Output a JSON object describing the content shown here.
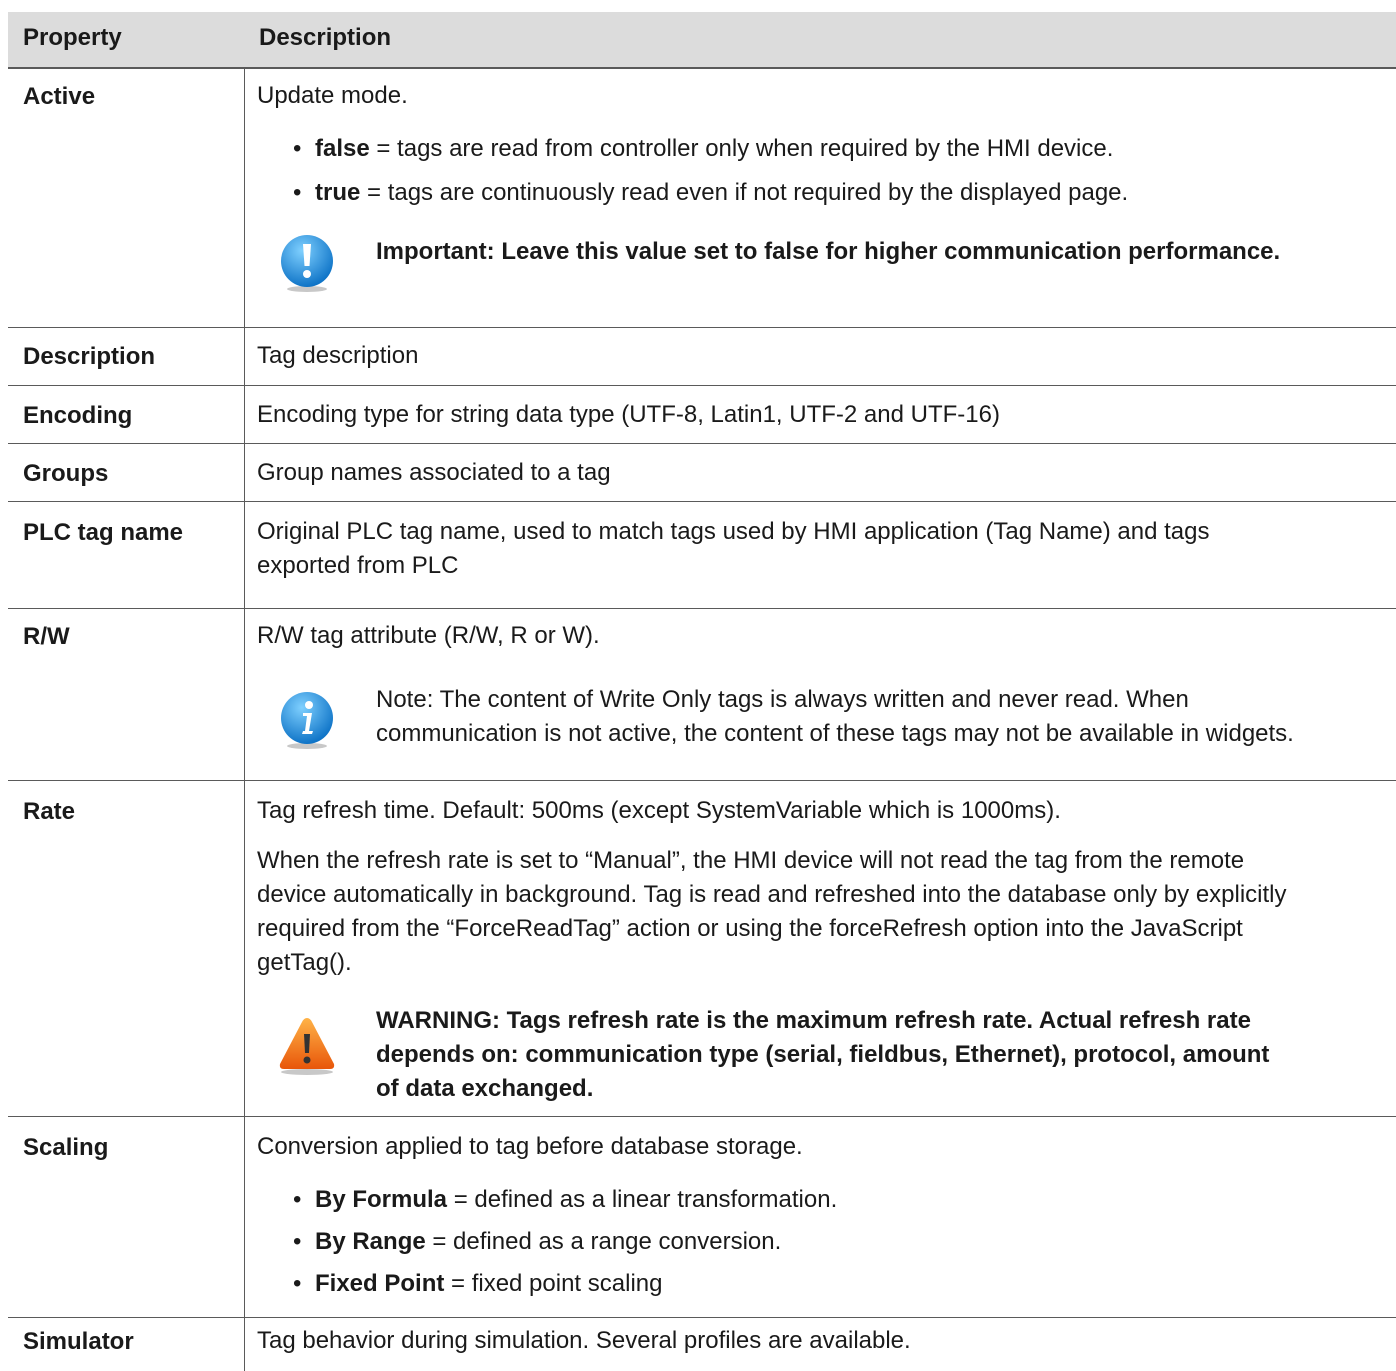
{
  "table": {
    "header": {
      "property": "Property",
      "description": "Description"
    },
    "rows": {
      "active": {
        "name": "Active",
        "intro": "Update mode.",
        "bullets": [
          {
            "term": "false",
            "text": " = tags are read from controller only when required by the HMI device."
          },
          {
            "term": "true",
            "text": " = tags are continuously read even if not required by the displayed page."
          }
        ],
        "callout": {
          "icon": "important-icon",
          "text": "Important: Leave this value set to false for higher communication performance."
        }
      },
      "description": {
        "name": "Description",
        "text": "Tag description"
      },
      "encoding": {
        "name": "Encoding",
        "text": "Encoding type for string data type (UTF-8, Latin1, UTF-2 and UTF-16)"
      },
      "groups": {
        "name": "Groups",
        "text": "Group names associated to a tag"
      },
      "plc_tag_name": {
        "name": "PLC tag name",
        "line1": "Original PLC tag name, used to match tags used by HMI application (Tag Name) and tags",
        "line2": "exported from PLC"
      },
      "rw": {
        "name": "R/W",
        "text": "R/W tag attribute (R/W, R or W).",
        "callout": {
          "icon": "info-icon",
          "line1": "Note: The content of Write Only tags is always written and never read. When",
          "line2": "communication is not active, the content of these tags may not be available in widgets."
        }
      },
      "rate": {
        "name": "Rate",
        "text": "Tag refresh time. Default: 500ms (except SystemVariable which is 1000ms).",
        "para": [
          "When the refresh rate is set to “Manual”, the HMI device will not read the tag from the remote",
          "device automatically in background. Tag is read and refreshed into the database only by explicitly",
          "required from the “ForceReadTag” action or using the forceRefresh option into the JavaScript",
          "getTag()."
        ],
        "callout": {
          "icon": "warning-icon",
          "lines": [
            "WARNING: Tags refresh rate is the maximum refresh rate. Actual refresh rate",
            "depends on: communication type (serial, fieldbus, Ethernet), protocol, amount",
            "of data exchanged."
          ]
        }
      },
      "scaling": {
        "name": "Scaling",
        "text": "Conversion applied to tag before database storage.",
        "bullets": [
          {
            "term": "By Formula",
            "text": " = defined as a linear transformation."
          },
          {
            "term": "By Range",
            "text": " = defined as a range conversion."
          },
          {
            "term": "Fixed Point",
            "text": " = fixed point scaling"
          }
        ]
      },
      "simulator": {
        "name": "Simulator",
        "text": "Tag behavior during simulation. Several profiles are available."
      }
    }
  }
}
